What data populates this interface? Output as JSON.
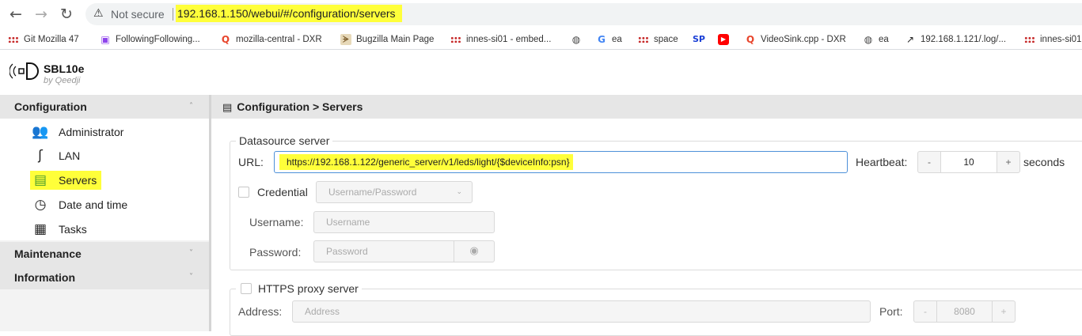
{
  "browser": {
    "not_secure": "Not secure",
    "url": "192.168.1.150/webui/#/configuration/servers",
    "bookmarks": [
      {
        "label": "Git Mozilla 47",
        "icon": "dots-icon"
      },
      {
        "label": "FollowingFollowing...",
        "icon": "twitch-icon"
      },
      {
        "label": "mozilla-central - DXR",
        "icon": "dxr-icon"
      },
      {
        "label": "Bugzilla Main Page",
        "icon": "bugzilla-icon"
      },
      {
        "label": "innes-si01 - embed...",
        "icon": "dots-icon"
      },
      {
        "label": "",
        "icon": "globe-icon"
      },
      {
        "label": "ea",
        "icon": "google-icon"
      },
      {
        "label": "space",
        "icon": "dots-icon"
      },
      {
        "label": "",
        "icon": "sp-icon"
      },
      {
        "label": "",
        "icon": "youtube-icon"
      },
      {
        "label": "VideoSink.cpp - DXR",
        "icon": "dxr-icon"
      },
      {
        "label": "ea",
        "icon": "globe-icon"
      },
      {
        "label": "192.168.1.121/.log/...",
        "icon": "arrow-icon"
      },
      {
        "label": "innes-si01",
        "icon": "dots-icon"
      }
    ]
  },
  "app": {
    "name": "SBL10e",
    "by": "by Qeedji"
  },
  "sidebar": {
    "configuration": "Configuration",
    "items": [
      {
        "label": "Administrator",
        "icon": "users-icon"
      },
      {
        "label": "LAN",
        "icon": "lan-icon"
      },
      {
        "label": "Servers",
        "icon": "server-icon"
      },
      {
        "label": "Date and time",
        "icon": "clock-icon"
      },
      {
        "label": "Tasks",
        "icon": "calendar-icon"
      }
    ],
    "maintenance": "Maintenance",
    "information": "Information"
  },
  "main": {
    "title": "Configuration > Servers",
    "datasource": {
      "legend": "Datasource server",
      "url_label": "URL:",
      "url_value": "https://192.168.1.122/generic_server/v1/leds/light/{$deviceInfo:psn}",
      "heartbeat_label": "Heartbeat:",
      "heartbeat_minus": "-",
      "heartbeat_value": "10",
      "heartbeat_plus": "+",
      "heartbeat_unit": "seconds",
      "credential_label": "Credential",
      "credential_select": "Username/Password",
      "username_label": "Username:",
      "username_placeholder": "Username",
      "password_label": "Password:",
      "password_placeholder": "Password"
    },
    "proxy": {
      "legend": "HTTPS proxy server",
      "address_label": "Address:",
      "address_placeholder": "Address",
      "port_label": "Port:",
      "port_minus": "-",
      "port_value": "8080",
      "port_plus": "+"
    }
  },
  "colors": {
    "highlight": "#ffff3a",
    "focus_border": "#4d90d9",
    "menu_bg": "#e6e6e6"
  }
}
